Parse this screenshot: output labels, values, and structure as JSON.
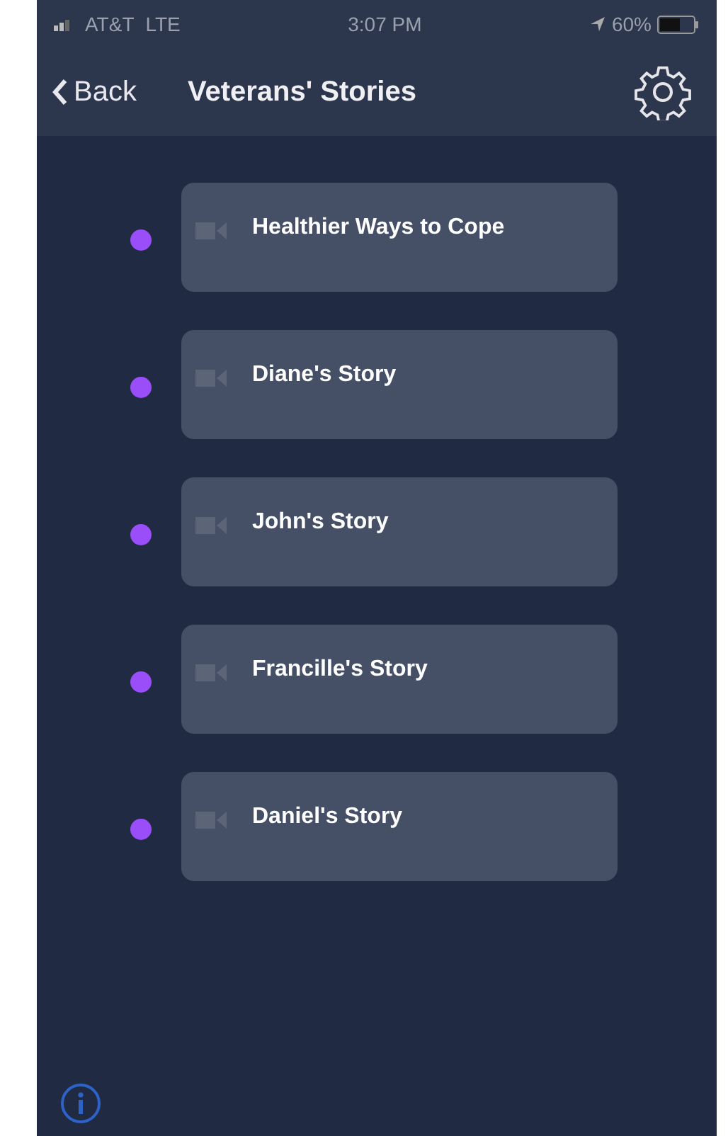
{
  "status_bar": {
    "carrier": "AT&T",
    "network": "LTE",
    "time": "3:07 PM",
    "battery": "60%"
  },
  "nav": {
    "back": "Back",
    "title": "Veterans' Stories"
  },
  "stories": [
    {
      "title": "Healthier Ways to Cope"
    },
    {
      "title": "Diane's Story"
    },
    {
      "title": "John's Story"
    },
    {
      "title": "Francille's Story"
    },
    {
      "title": "Daniel's Story"
    }
  ]
}
